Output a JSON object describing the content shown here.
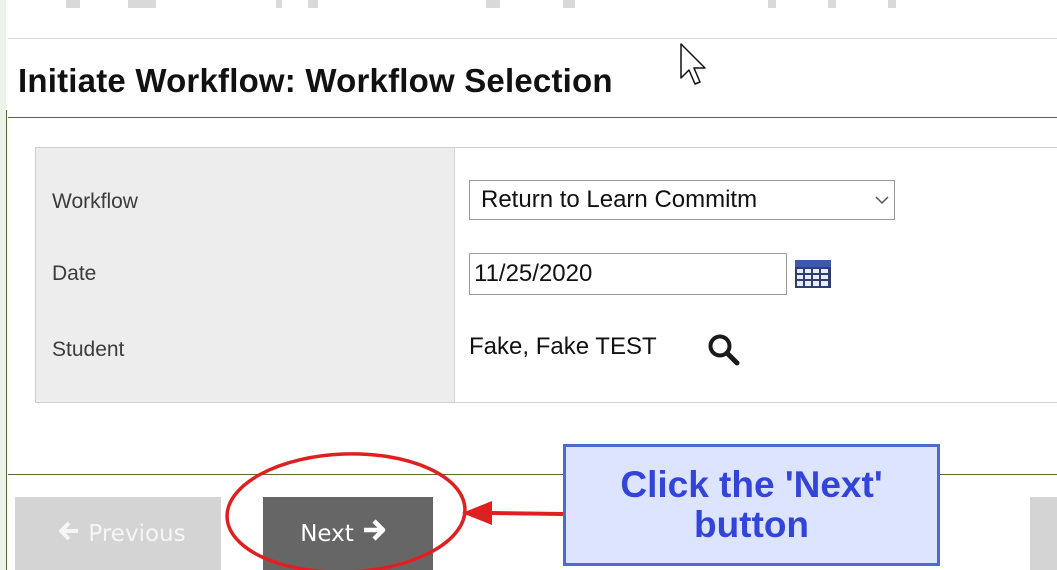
{
  "page": {
    "title": "Initiate Workflow: Workflow Selection"
  },
  "form": {
    "workflow": {
      "label": "Workflow",
      "selected": "Return to Learn Commitm"
    },
    "date": {
      "label": "Date",
      "value": "11/25/2020"
    },
    "student": {
      "label": "Student",
      "value": "Fake, Fake TEST"
    }
  },
  "buttons": {
    "previous_label": "Previous",
    "next_label": "Next"
  },
  "annotation": {
    "line1": "Click the 'Next'",
    "line2": "button"
  },
  "icons": {
    "calendar": "calendar-icon",
    "search": "magnifier-search-icon",
    "prev_arrow": "arrow-left-icon",
    "next_arrow": "arrow-right-icon",
    "select_chevron": "chevron-down-icon",
    "cursor": "mouse-pointer-icon"
  },
  "colors": {
    "title_rule": "#556b2f",
    "next_button": "#666666",
    "previous_button_disabled": "#d4d4d4",
    "callout_fill": "#dde4ff",
    "callout_text": "#3344d9",
    "callout_border": "#4e6ad0",
    "annotation_red": "#e02020"
  }
}
